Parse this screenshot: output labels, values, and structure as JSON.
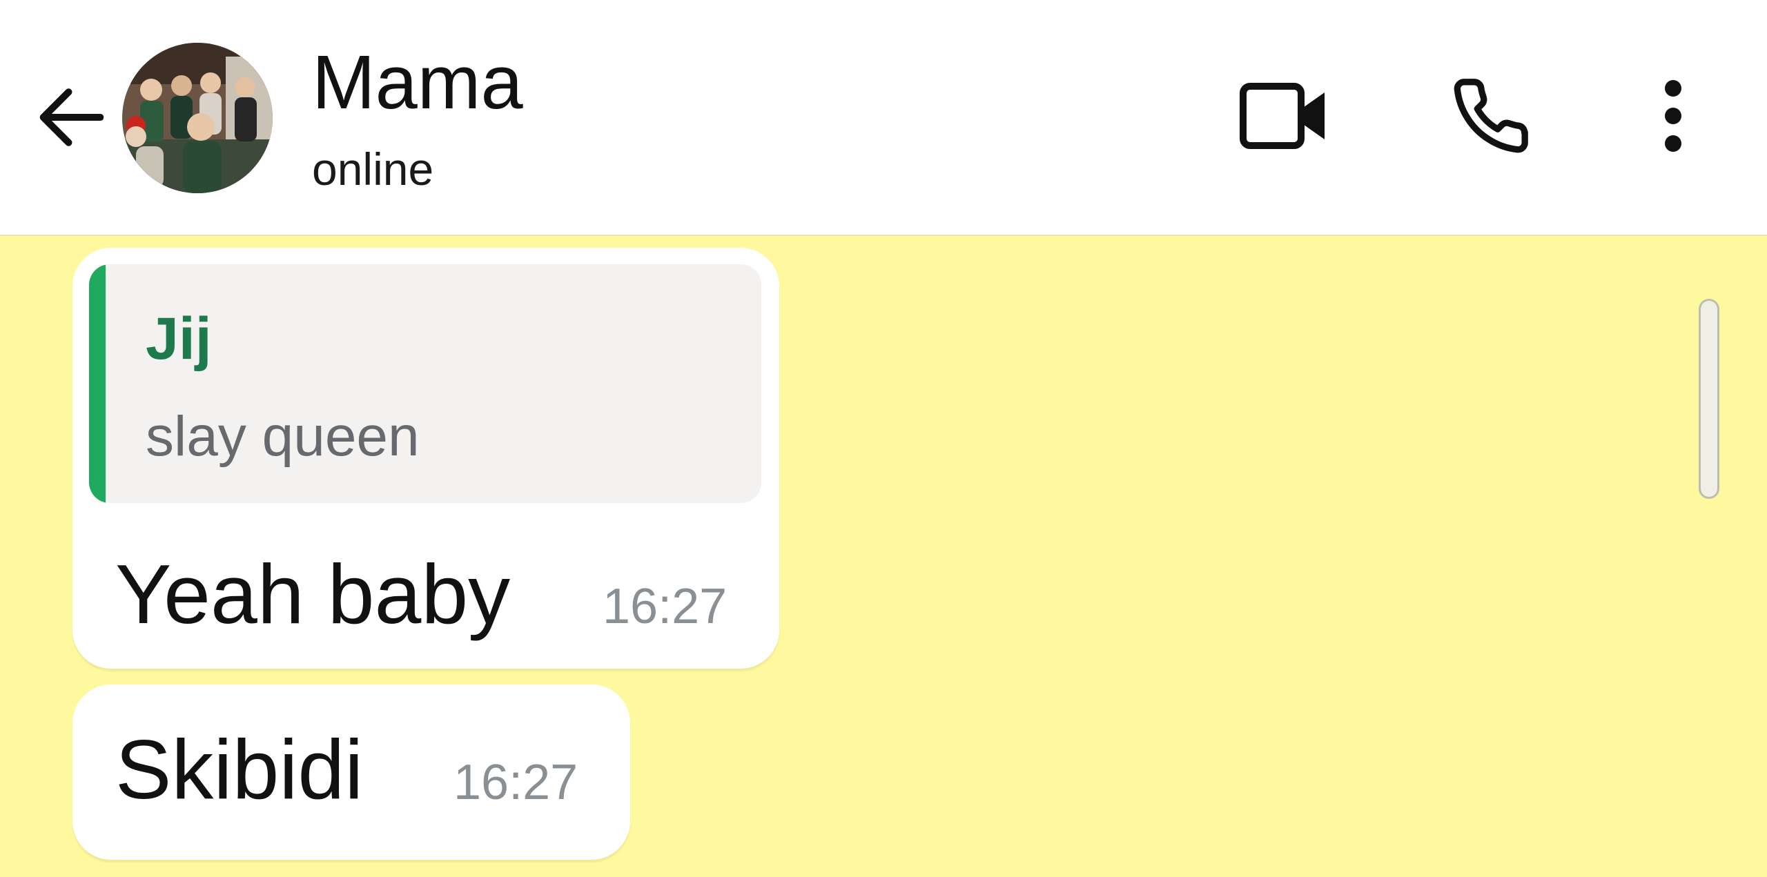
{
  "header": {
    "contact_name": "Mama",
    "status": "online",
    "icons": {
      "back": "arrow-left-icon",
      "video": "video-camera-icon",
      "call": "phone-icon",
      "more": "more-vertical-icon"
    }
  },
  "chat": {
    "background_color": "#fef99f",
    "messages": [
      {
        "quoted": {
          "sender": "Jij",
          "text": "slay queen",
          "accent_color": "#1faa60"
        },
        "text": "Yeah baby",
        "time": "16:27"
      },
      {
        "text": "Skibidi",
        "time": "16:27"
      }
    ]
  }
}
